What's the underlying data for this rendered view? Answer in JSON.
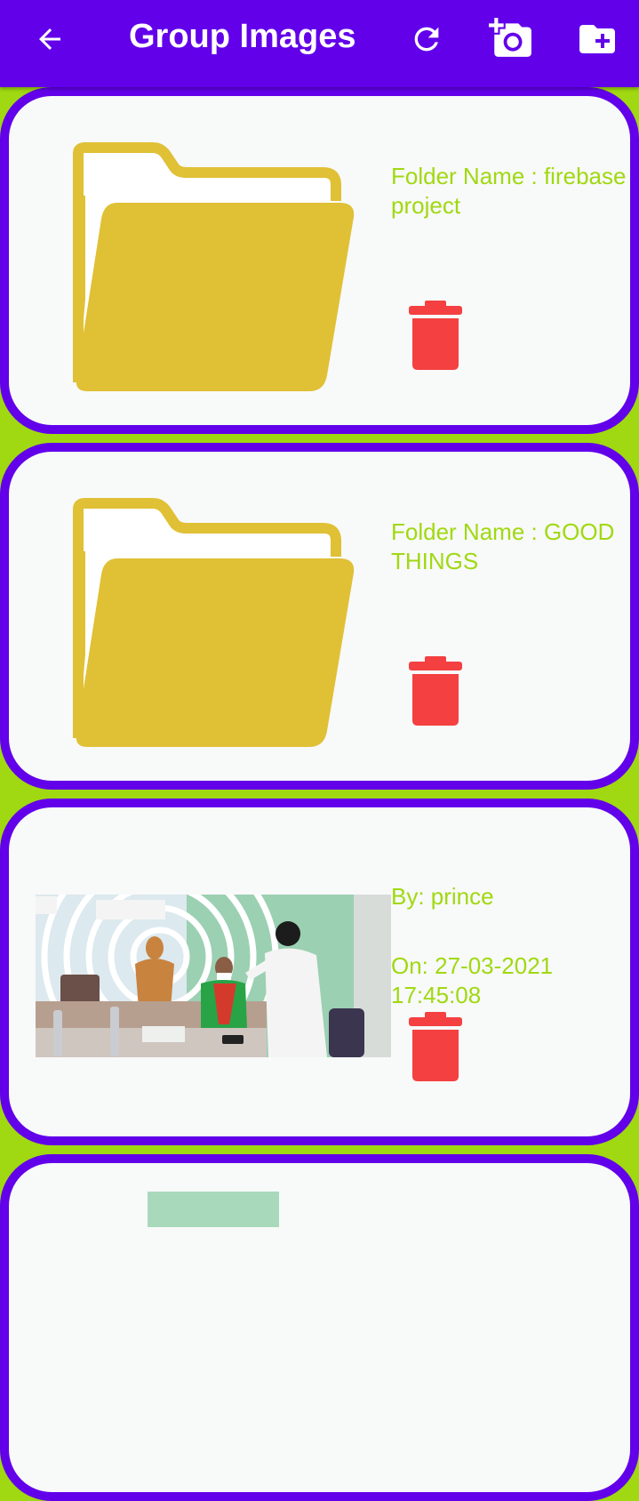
{
  "app_bar": {
    "title": "Group Images",
    "icons": [
      "arrow-back-icon",
      "refresh-icon",
      "add-photo-icon",
      "create-folder-icon"
    ]
  },
  "items": [
    {
      "type": "folder",
      "label": "Folder Name : firebase project",
      "icon": "folder-icon"
    },
    {
      "type": "folder",
      "label": "Folder Name : GOOD THINGS",
      "icon": "folder-icon"
    },
    {
      "type": "image",
      "by": "By: prince",
      "on": "On: 27-03-2021 17:45:08"
    }
  ],
  "colors": {
    "app_bar": "#6200ea",
    "background": "#a0d911",
    "card": "#f8f9f9",
    "text": "#a0d911",
    "folder": "#e0c035",
    "delete": "#f44040"
  }
}
